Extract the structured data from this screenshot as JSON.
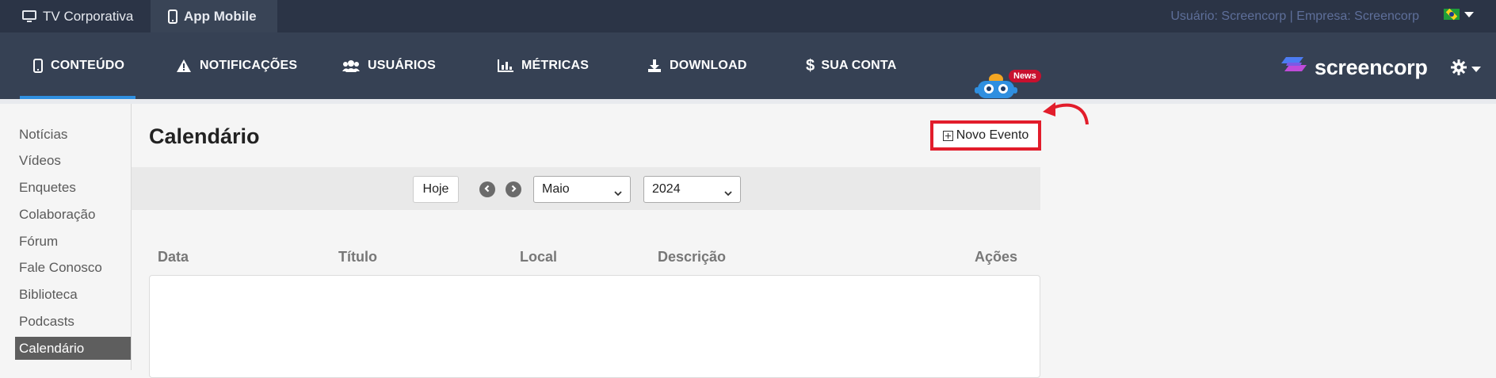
{
  "topbar": {
    "tabs": [
      {
        "label": "TV Corporativa",
        "icon": "monitor-icon"
      },
      {
        "label": "App Mobile",
        "icon": "mobile-icon"
      }
    ],
    "user_info": "Usuário: Screencorp | Empresa: Screencorp"
  },
  "nav": {
    "items": [
      {
        "label": "CONTEÚDO",
        "icon": "mobile-icon"
      },
      {
        "label": "NOTIFICAÇÕES",
        "icon": "warning-icon"
      },
      {
        "label": "USUÁRIOS",
        "icon": "users-icon"
      },
      {
        "label": "MÉTRICAS",
        "icon": "bar-chart-icon"
      },
      {
        "label": "DOWNLOAD",
        "icon": "download-icon"
      },
      {
        "label": "SUA CONTA",
        "icon": "dollar-icon"
      }
    ],
    "news_badge": "News",
    "logo_text": "screencorp"
  },
  "sidebar": {
    "items": [
      "Notícias",
      "Vídeos",
      "Enquetes",
      "Colaboração",
      "Fórum",
      "Fale Conosco",
      "Biblioteca",
      "Podcasts"
    ],
    "active": "Calendário"
  },
  "main": {
    "title": "Calendário",
    "new_event_label": "Novo Evento",
    "today_label": "Hoje",
    "month": "Maio",
    "year": "2024",
    "columns": [
      "Data",
      "Título",
      "Local",
      "Descrição",
      "Ações"
    ]
  },
  "colors": {
    "topbar": "#2b3446",
    "navbar": "#364154",
    "accent": "#2f8fe0",
    "highlight": "#e21d2b"
  }
}
